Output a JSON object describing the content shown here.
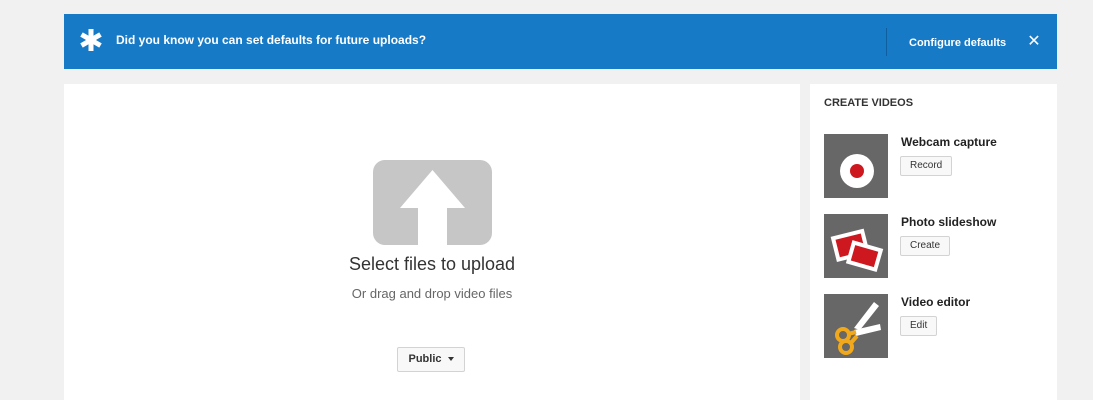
{
  "banner": {
    "message": "Did you know you can set defaults for future uploads?",
    "configure_label": "Configure defaults",
    "close_label": "✕",
    "color": "#167ac6"
  },
  "upload": {
    "title": "Select files to upload",
    "subtitle": "Or drag and drop video files",
    "privacy_label": "Public"
  },
  "create_videos": {
    "heading": "CREATE VIDEOS",
    "tools": [
      {
        "name": "Webcam capture",
        "button": "Record",
        "icon": "record-icon"
      },
      {
        "name": "Photo slideshow",
        "button": "Create",
        "icon": "photos-icon"
      },
      {
        "name": "Video editor",
        "button": "Edit",
        "icon": "scissors-icon"
      }
    ]
  }
}
